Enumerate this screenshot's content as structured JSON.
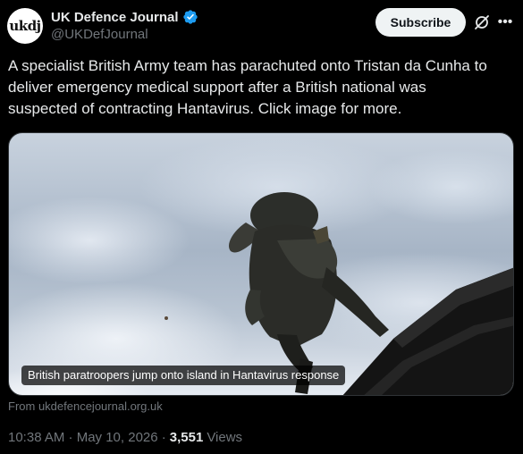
{
  "author": {
    "avatar_text": "ukdj",
    "display_name": "UK Defence Journal",
    "handle": "@UKDefJournal",
    "verified_icon": "verified-badge-icon",
    "verified_color": "#1d9bf0"
  },
  "actions": {
    "subscribe_label": "Subscribe",
    "grok_icon": "grok-icon",
    "more_label": "•••"
  },
  "tweet": {
    "text": "A specialist British Army team has parachuted onto Tristan da Cunha to\ndeliver emergency medical support after a British national was\nsuspected of contracting Hantavirus. Click image for more."
  },
  "media": {
    "caption": "British paratroopers jump onto island in Hantavirus response",
    "source": "From ukdefencejournal.org.uk"
  },
  "meta": {
    "timestamp": "10:38 AM · May 10, 2026 ·",
    "views_count": "3,551",
    "views_label": "Views"
  },
  "colors": {
    "background": "#000000",
    "text_primary": "#e7e9ea",
    "text_secondary": "#71767b",
    "subscribe_bg": "#eff3f4"
  }
}
